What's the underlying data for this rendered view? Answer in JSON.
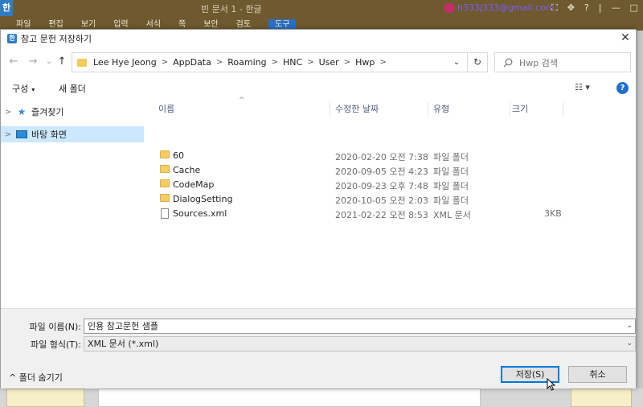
{
  "background_app": {
    "logo": "한",
    "title": "빈 문서 1 - 한글",
    "account": "h333j333@gmail.com",
    "window_controls": [
      "⛶",
      "✥",
      "?",
      "|",
      "—",
      "□",
      "✕"
    ],
    "menu": [
      "파일",
      "편집",
      "보기",
      "입력",
      "서식",
      "쪽",
      "보안",
      "검토",
      "도구"
    ],
    "active_menu": "도구"
  },
  "dialog": {
    "title": "참고 문헌 저장하기",
    "close_glyph": "✕",
    "nav": {
      "back_glyph": "←",
      "forward_glyph": "→",
      "recent_glyph": "⌄",
      "up_glyph": "↑",
      "breadcrumbs": [
        "Lee Hye Jeong",
        "AppData",
        "Roaming",
        "HNC",
        "User",
        "Hwp"
      ],
      "breadcrumb_sep": ">",
      "dropdown_glyph": "⌄",
      "refresh_glyph": "↻",
      "search_placeholder": "Hwp 검색"
    },
    "toolbar": {
      "organize_label": "구성",
      "caret": "▾",
      "new_folder_label": "새 폴더",
      "view_glyph": "☷ ▾",
      "help_glyph": "?"
    },
    "sidebar": {
      "items": [
        {
          "label": "즐겨찾기",
          "arrow": ">",
          "icon": "star-icon",
          "selected": false
        },
        {
          "label": "바탕 화면",
          "arrow": ">",
          "icon": "desktop-icon",
          "selected": true
        }
      ]
    },
    "file_list": {
      "sort_glyph": "^",
      "columns": [
        "이름",
        "수정한 날짜",
        "유형",
        "크기"
      ],
      "rows": [
        {
          "name": "60",
          "modified": "2020-02-20 오전 7:38",
          "type": "파일 폴더",
          "size": "",
          "kind": "folder"
        },
        {
          "name": "Cache",
          "modified": "2020-09-05 오전 4:23",
          "type": "파일 폴더",
          "size": "",
          "kind": "folder"
        },
        {
          "name": "CodeMap",
          "modified": "2020-09-23 오후 7:48",
          "type": "파일 폴더",
          "size": "",
          "kind": "folder"
        },
        {
          "name": "DialogSetting",
          "modified": "2020-10-05 오전 2:03",
          "type": "파일 폴더",
          "size": "",
          "kind": "folder"
        },
        {
          "name": "Sources.xml",
          "modified": "2021-02-22 오전 8:53",
          "type": "XML 문서",
          "size": "3KB",
          "kind": "file"
        }
      ]
    },
    "footer": {
      "filename_label": "파일 이름(N):",
      "filename_value": "인용 참고문헌 샘플",
      "filetype_label": "파일 형식(T):",
      "filetype_value": "XML 문서 (*.xml)",
      "dropdown_glyph": "⌄",
      "hide_folders_label": "폴더 숨기기",
      "hide_folders_glyph": "^",
      "save_label": "저장(S)",
      "cancel_label": "취소"
    }
  },
  "colors": {
    "title_bar": "#6e5a2e",
    "accent": "#0078d7",
    "selection": "#cce8ff",
    "folder": "#f6cd63"
  }
}
